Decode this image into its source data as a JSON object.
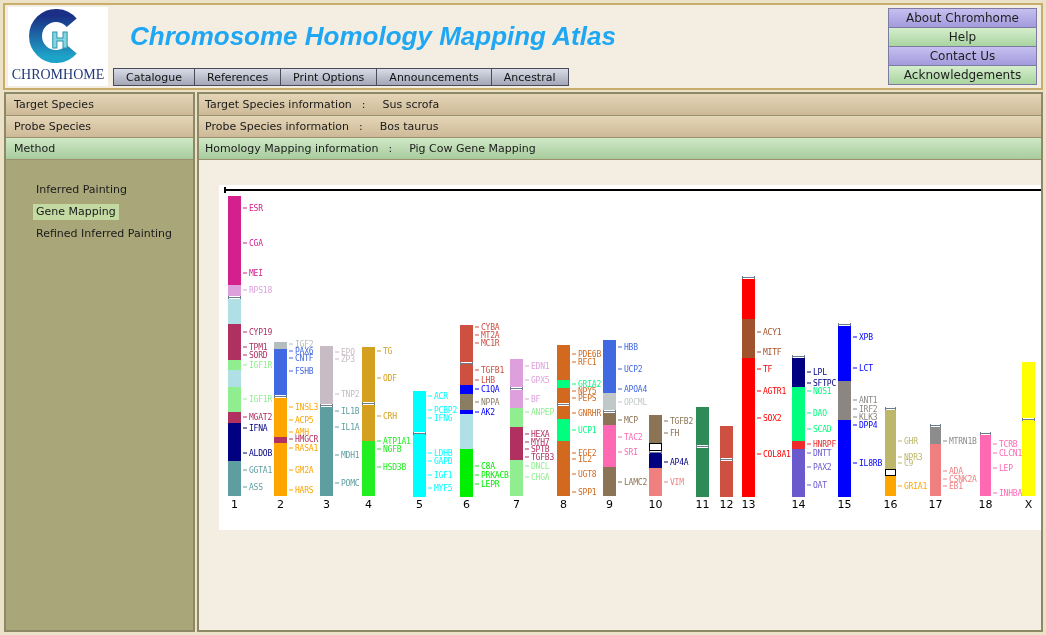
{
  "header": {
    "logo": {
      "mark": "H",
      "wordmark": "CHROMHOME"
    },
    "title": "Chromosome Homology Mapping Atlas",
    "nav_tabs": [
      "Catalogue",
      "References",
      "Print Options",
      "Announcements",
      "Ancestral"
    ],
    "side_menu": [
      "About Chromhome",
      "Help",
      "Contact Us",
      "Acknowledgements"
    ]
  },
  "sidebar": {
    "items": [
      {
        "label": "Target Species",
        "selected": false
      },
      {
        "label": "Probe Species",
        "selected": false
      },
      {
        "label": "Method",
        "selected": true
      }
    ],
    "methods": [
      {
        "label": "Inferred Painting",
        "selected": false
      },
      {
        "label": "Gene Mapping",
        "selected": true
      },
      {
        "label": "Refined Inferred Painting",
        "selected": false
      }
    ]
  },
  "info_rows": [
    {
      "label": "Target Species information",
      "separator": ":",
      "value": "Sus scrofa",
      "selected": false
    },
    {
      "label": "Probe Species information",
      "separator": ":",
      "value": "Bos taurus",
      "selected": false
    },
    {
      "label": "Homology Mapping information",
      "separator": ":",
      "value": "Pig Cow Gene Mapping",
      "selected": true
    }
  ],
  "ideogram": {
    "chromosomes": [
      {
        "name": "1",
        "bands": [
          {
            "color": "#d4208c",
            "genes": [
              "ESR",
              "CGA",
              "MEI"
            ]
          },
          {
            "color": "#dda0dd",
            "genes": [
              "RPS18"
            ]
          },
          {
            "color": "#b0e0e6"
          },
          {
            "color": "#b03060",
            "genes": [
              "CYP19",
              "TPM1",
              "SORD"
            ]
          },
          {
            "color": "#90ee90",
            "genes": [
              "IGF1R"
            ]
          },
          {
            "color": "#b0e0e6"
          },
          {
            "color": "#90ee90",
            "genes": [
              "IGF1R"
            ]
          },
          {
            "color": "#b03060",
            "genes": [
              "MGAT2"
            ]
          },
          {
            "color": "#000080",
            "genes": [
              "IFNA",
              "ALDOB"
            ]
          },
          {
            "color": "#5f9ea0",
            "genes": [
              "GGTA1",
              "ASS"
            ]
          }
        ]
      },
      {
        "name": "2",
        "bands": [
          {
            "color": "#b4bebe",
            "genes": [
              "IGF2"
            ]
          },
          {
            "color": "#4169e1",
            "genes": [
              "PAX6",
              "CNTF",
              "FSHB"
            ]
          },
          {
            "color": "#ffa500",
            "genes": [
              "INSL3",
              "ACP5",
              "AMH"
            ]
          },
          {
            "color": "#b03060",
            "genes": [
              "HMGCR"
            ]
          },
          {
            "color": "#ffa500",
            "genes": [
              "RASA1",
              "GM2A",
              "HARS"
            ]
          }
        ]
      },
      {
        "name": "3",
        "bands": [
          {
            "color": "#c8bcc4",
            "genes": [
              "EPO",
              "ZP3",
              "TNP2"
            ]
          },
          {
            "color": "#5f9ea0",
            "genes": [
              "IL1B",
              "IL1A",
              "MDH1",
              "POMC"
            ]
          }
        ]
      },
      {
        "name": "4",
        "bands": [
          {
            "color": "#d4a020",
            "genes": [
              "TG",
              "ODF"
            ]
          },
          {
            "color": "#d4a020",
            "genes": [
              "CRH"
            ]
          },
          {
            "color": "#22ee22",
            "genes": [
              "ATP1A1",
              "NGFB",
              "HSD3B"
            ]
          }
        ]
      },
      {
        "name": "5",
        "bands": [
          {
            "color": "#00ffff",
            "genes": [
              "ACR",
              "PCBP2",
              "IFNG"
            ]
          },
          {
            "color": "#00ffff",
            "genes": [
              "LDHB",
              "GAPD",
              "IGF1",
              "MYF5"
            ]
          }
        ]
      },
      {
        "name": "6",
        "bands": [
          {
            "color": "#cd5040",
            "genes": [
              "CYBA",
              "MT2A",
              "MC1R"
            ]
          },
          {
            "color": "#cd5040",
            "genes": [
              "TGFB1",
              "LHB"
            ]
          },
          {
            "color": "#0000ff",
            "genes": [
              "C1QA"
            ]
          },
          {
            "color": "#8b7d62",
            "genes": [
              "NPPA"
            ]
          },
          {
            "color": "#0000ff",
            "genes": [
              "AK2"
            ]
          },
          {
            "color": "#b0e0e6"
          },
          {
            "color": "#00ee00",
            "genes": [
              "C8A",
              "PRKACB",
              "LEPR"
            ]
          }
        ]
      },
      {
        "name": "7",
        "bands": [
          {
            "color": "#dda0dd",
            "genes": [
              "EDN1",
              "GPX5"
            ]
          },
          {
            "color": "#dda0dd",
            "genes": [
              "BF"
            ]
          },
          {
            "color": "#90ee90",
            "genes": [
              "ANPEP"
            ]
          },
          {
            "color": "#b03060",
            "genes": [
              "HEXA",
              "MYH7",
              "SPTB",
              "TGFB3"
            ]
          },
          {
            "color": "#90ee90",
            "genes": [
              "DNCL",
              "CHGA"
            ]
          }
        ]
      },
      {
        "name": "8",
        "bands": [
          {
            "color": "#d2691e",
            "genes": [
              "PDE6B",
              "RFC1"
            ]
          },
          {
            "color": "#00ff7f",
            "genes": [
              "GRIA2"
            ]
          },
          {
            "color": "#d2691e",
            "genes": [
              "NPY5",
              "PEPS"
            ]
          },
          {
            "color": "#d2691e",
            "genes": [
              "GNRHR"
            ]
          },
          {
            "color": "#00ff7f",
            "genes": [
              "UCP1"
            ]
          },
          {
            "color": "#d2691e",
            "genes": [
              "FGF2",
              "IL2",
              "UGT8",
              "SPP1"
            ]
          }
        ]
      },
      {
        "name": "9",
        "bands": [
          {
            "color": "#4169e1",
            "genes": [
              "HBB",
              "UCP2",
              "APOA4"
            ]
          },
          {
            "color": "#c0c8c8",
            "genes": [
              "OPCML"
            ]
          },
          {
            "color": "#8b7355",
            "genes": [
              "MCP"
            ]
          },
          {
            "color": "#ff69b4",
            "genes": [
              "TAC2",
              "SRI"
            ]
          },
          {
            "color": "#8b7355",
            "genes": [
              "LAMC2"
            ]
          }
        ]
      },
      {
        "name": "10",
        "bands": [
          {
            "color": "#8b7355",
            "genes": [
              "TGFB2",
              "FH"
            ]
          },
          {
            "color": "#ffffff"
          },
          {
            "color": "#000080",
            "genes": [
              "AP4A"
            ]
          },
          {
            "color": "#f08080",
            "genes": [
              "VIM"
            ]
          }
        ]
      },
      {
        "name": "11",
        "bands": [
          {
            "color": "#2e8b57"
          },
          {
            "color": "#2e8b57"
          }
        ]
      },
      {
        "name": "12",
        "bands": [
          {
            "color": "#cd5040"
          },
          {
            "color": "#cd5040"
          }
        ]
      },
      {
        "name": "13",
        "bands": [
          {
            "color": "#ff0000"
          },
          {
            "color": "#a0522d",
            "genes": [
              "ACY1",
              "MITF"
            ]
          },
          {
            "color": "#ff0000",
            "genes": [
              "TF",
              "AGTR1",
              "SOX2",
              "COL8A1"
            ]
          }
        ]
      },
      {
        "name": "14",
        "bands": [
          {
            "color": "#000080",
            "genes": [
              "LPL",
              "SFTPC"
            ]
          },
          {
            "color": "#00ff7f",
            "genes": [
              "NOS1",
              "DAO",
              "SCAD"
            ]
          },
          {
            "color": "#ee2c2c",
            "genes": [
              "HNRPF"
            ]
          },
          {
            "color": "#6a5acd",
            "genes": [
              "DNTT",
              "PAX2",
              "OAT"
            ]
          }
        ]
      },
      {
        "name": "15",
        "bands": [
          {
            "color": "#0000ff",
            "genes": [
              "XPB",
              "LCT"
            ]
          },
          {
            "color": "#8b8682",
            "genes": [
              "ANT1",
              "IRF2",
              "KLK3"
            ]
          },
          {
            "color": "#0000ff",
            "genes": [
              "DPP4",
              "IL8RB"
            ]
          }
        ]
      },
      {
        "name": "16",
        "bands": [
          {
            "color": "#bdb76b",
            "genes": [
              "GHR",
              "NPR3",
              "C9"
            ]
          },
          {
            "color": "#ffffff"
          },
          {
            "color": "#ffa500",
            "genes": [
              "GRIA1"
            ]
          }
        ]
      },
      {
        "name": "17",
        "bands": [
          {
            "color": "#8c8c8c",
            "genes": [
              "MTRN1B"
            ]
          },
          {
            "color": "#f08080",
            "genes": [
              "ADA",
              "CSNK2A",
              "EB1"
            ]
          }
        ]
      },
      {
        "name": "18",
        "bands": [
          {
            "color": "#ff69b4",
            "genes": [
              "TCRB",
              "CLCN1",
              "LEP",
              "INHBA"
            ]
          }
        ]
      },
      {
        "name": "X",
        "bands": [
          {
            "color": "#ffff00"
          },
          {
            "color": "#ffff00"
          }
        ]
      }
    ]
  }
}
